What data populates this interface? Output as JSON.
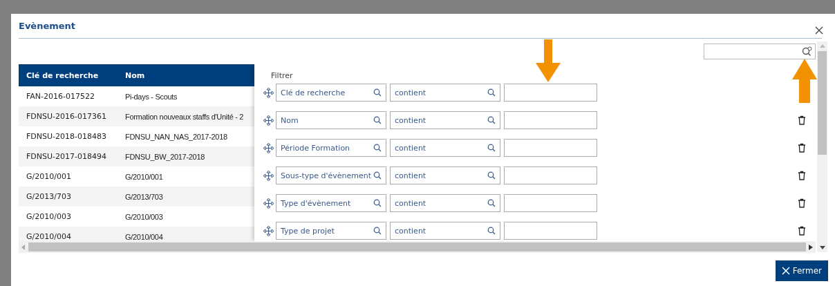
{
  "dialog": {
    "title": "Evènement"
  },
  "table": {
    "columns": [
      "Clé de recherche",
      "Nom"
    ],
    "rows": [
      {
        "cells": [
          "FAN-2016-017522",
          "Pi-days - Scouts"
        ]
      },
      {
        "cells": [
          "FDNSU-2016-017361",
          "Formation nouveaux staffs d'Unité - 2"
        ]
      },
      {
        "cells": [
          "FDNSU-2018-018483",
          "FDNSU_NAN_NAS_2017-2018"
        ]
      },
      {
        "cells": [
          "FDNSU-2017-018494",
          "FDNSU_BW_2017-2018"
        ]
      },
      {
        "cells": [
          "G/2010/001",
          "G/2010/001"
        ]
      },
      {
        "cells": [
          "G/2013/703",
          "G/2013/703"
        ]
      },
      {
        "cells": [
          "G/2010/003",
          "G/2010/003"
        ]
      },
      {
        "cells": [
          "G/2010/004",
          "G/2010/004"
        ]
      }
    ]
  },
  "filter": {
    "title": "Filtrer",
    "rows": [
      {
        "field": "Clé de recherche",
        "operator": "contient",
        "value": "",
        "deletable": false
      },
      {
        "field": "Nom",
        "operator": "contient",
        "value": "",
        "deletable": true
      },
      {
        "field": "Période Formation",
        "operator": "contient",
        "value": "",
        "deletable": true
      },
      {
        "field": "Sous-type d'évènement",
        "operator": "contient",
        "value": "",
        "deletable": true
      },
      {
        "field": "Type d'évènement",
        "operator": "contient",
        "value": "",
        "deletable": true
      },
      {
        "field": "Type de projet",
        "operator": "contient",
        "value": "",
        "deletable": true
      }
    ]
  },
  "buttons": [
    {
      "label": "Fermer"
    }
  ]
}
